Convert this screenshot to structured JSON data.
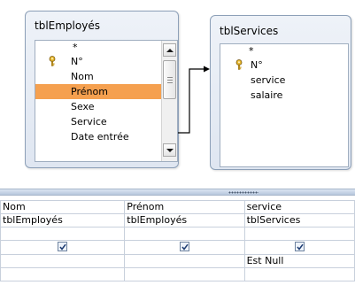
{
  "tables": {
    "employes": {
      "title": "tblEmployés",
      "fields": [
        "*",
        "N°",
        "Nom",
        "Prénom",
        "Sexe",
        "Service",
        "Date entrée"
      ],
      "selected_field": "Prénom",
      "key_field": "N°"
    },
    "services": {
      "title": "tblServices",
      "fields": [
        "*",
        "N°",
        "service",
        "salaire"
      ],
      "key_field": "N°"
    }
  },
  "grid": {
    "columns": [
      {
        "field": "Nom",
        "table": "tblEmployés",
        "show": true,
        "criteria": ""
      },
      {
        "field": "Prénom",
        "table": "tblEmployés",
        "show": true,
        "criteria": ""
      },
      {
        "field": "service",
        "table": "tblServices",
        "show": true,
        "criteria": "Est Null"
      }
    ]
  },
  "icons": {
    "key": "key-icon",
    "scroll_up": "scroll-up-arrow-icon",
    "scroll_down": "scroll-down-arrow-icon",
    "checkbox": "checkmark-icon",
    "join": "join-arrow-icon"
  },
  "colors": {
    "selection": "#f5a04f",
    "table_border": "#8da0b8",
    "join_line": "#000000"
  }
}
